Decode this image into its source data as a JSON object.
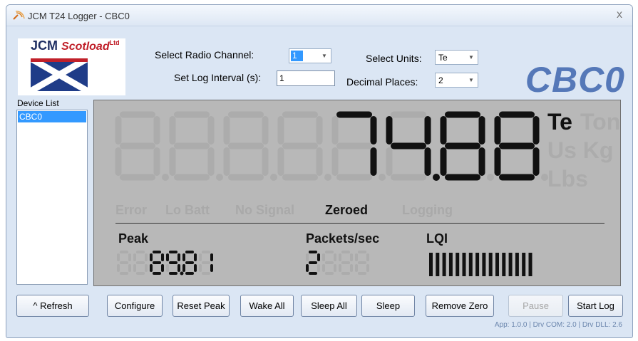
{
  "window": {
    "title": "JCM T24 Logger - CBC0",
    "close_glyph": "x"
  },
  "logo": {
    "brand": "JCM",
    "sub": "Scotload",
    "suffix": "Ltd"
  },
  "settings": {
    "radio_channel_label": "Select Radio Channel:",
    "radio_channel_value": "1",
    "log_interval_label": "Set Log Interval (s):",
    "log_interval_value": "1",
    "units_label": "Select Units:",
    "units_value": "Te",
    "decimal_places_label": "Decimal Places:",
    "decimal_places_value": "2"
  },
  "device_name": "CBC0",
  "device_list": {
    "label": "Device List",
    "items": [
      "CBC0"
    ]
  },
  "display": {
    "reading": "74.88",
    "units": {
      "active": "Te",
      "inactive": [
        "Ton",
        "Us Kg",
        "Lbs"
      ]
    },
    "status": {
      "error": "Error",
      "lo_batt": "Lo Batt",
      "no_signal": "No Signal",
      "zeroed": "Zeroed",
      "logging": "Logging",
      "active": "Zeroed"
    },
    "peak": {
      "label": "Peak",
      "value": "89.81"
    },
    "packets": {
      "label": "Packets/sec",
      "value": "2"
    },
    "lqi": {
      "label": "LQI",
      "bars": 16
    }
  },
  "buttons": {
    "refresh": "^ Refresh",
    "configure": "Configure",
    "reset_peak": "Reset Peak",
    "wake_all": "Wake All",
    "sleep_all": "Sleep All",
    "sleep": "Sleep",
    "remove_zero": "Remove Zero",
    "pause": "Pause",
    "start_log": "Start Log"
  },
  "version": "App: 1.0.0 | Drv COM: 2.0 | Drv DLL: 2.6",
  "colors": {
    "accent": "#5578b8",
    "lcd_bg": "#b8b8b8",
    "lcd_on": "#111111",
    "lcd_off": "#acacac",
    "selection": "#3399ff"
  }
}
